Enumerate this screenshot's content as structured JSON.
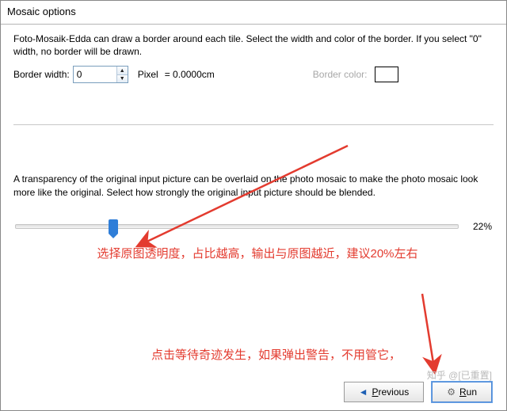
{
  "title": "Mosaic options",
  "border_desc": "Foto-Mosaik-Edda can draw a border around each tile. Select the width and color of the border. If you select \"0\" width, no border will be drawn.",
  "border_width_label": "Border width:",
  "border_width_value": "0",
  "border_unit": "Pixel",
  "border_eq": "= 0.0000cm",
  "border_color_label": "Border color:",
  "transparency_desc": "A transparency of the original input picture can be overlaid on the photo mosaic to make the photo mosaic look more like the original. Select how strongly the original input picture should be blended.",
  "slider_percent": "22%",
  "slider_value_pct": 22,
  "annotation1": "选择原图透明度，占比越高，输出与原图越近，建议20%左右",
  "annotation2": "点击等待奇迹发生，如果弹出警告，不用管它，",
  "buttons": {
    "previous_prefix": "P",
    "previous_rest": "revious",
    "run_prefix": "R",
    "run_rest": "un"
  },
  "watermark": "知乎 @[已重置]",
  "icons": {
    "arrow_left": "◄",
    "gear": "⚙",
    "spin_up": "▲",
    "spin_down": "▼"
  },
  "colors": {
    "annotation": "#e33b2f",
    "accent": "#2f7ed8"
  }
}
